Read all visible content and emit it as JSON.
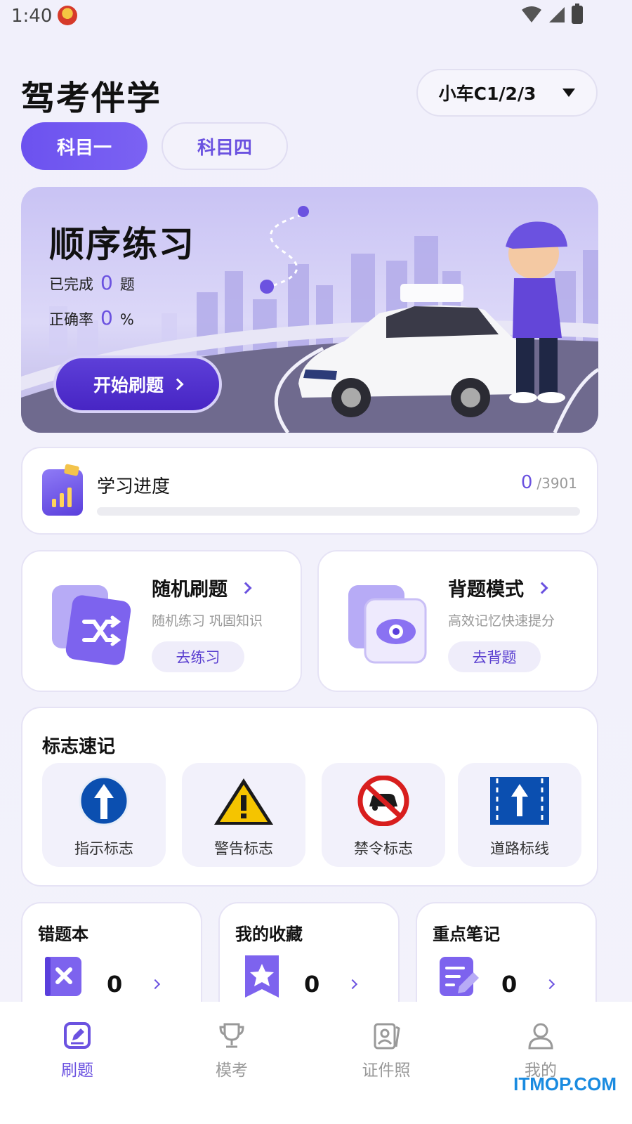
{
  "status_bar": {
    "time": "1:40"
  },
  "header": {
    "title": "驾考伴学",
    "car_type": "小车C1/2/3",
    "tabs": [
      {
        "label": "科目一",
        "active": true
      },
      {
        "label": "科目四",
        "active": false
      }
    ]
  },
  "banner": {
    "title": "顺序练习",
    "done_label": "已完成",
    "done_value": "0",
    "done_unit": "题",
    "rate_label": "正确率",
    "rate_value": "0",
    "rate_unit": "%",
    "button_label": "开始刷题"
  },
  "progress": {
    "label": "学习进度",
    "done": "0",
    "total": "/3901",
    "fraction": 0
  },
  "features": [
    {
      "title": "随机刷题",
      "subtitle": "随机练习 巩固知识",
      "button": "去练习",
      "icon": "shuffle-icon"
    },
    {
      "title": "背题模式",
      "subtitle": "高效记忆快速提分",
      "button": "去背题",
      "icon": "eye-icon"
    }
  ],
  "signs": {
    "title": "标志速记",
    "items": [
      {
        "label": "指示标志",
        "icon": "arrow-up-sign-icon"
      },
      {
        "label": "警告标志",
        "icon": "warning-sign-icon"
      },
      {
        "label": "禁令标志",
        "icon": "no-car-sign-icon"
      },
      {
        "label": "道路标线",
        "icon": "road-marking-icon"
      }
    ]
  },
  "mini_cards": [
    {
      "title": "错题本",
      "count": "0",
      "icon": "wrong-book-icon"
    },
    {
      "title": "我的收藏",
      "count": "0",
      "icon": "favorite-icon"
    },
    {
      "title": "重点笔记",
      "count": "0",
      "icon": "notes-icon"
    }
  ],
  "bottom_nav": [
    {
      "label": "刷题",
      "active": true,
      "icon": "practice-icon"
    },
    {
      "label": "模考",
      "active": false,
      "icon": "trophy-icon"
    },
    {
      "label": "证件照",
      "active": false,
      "icon": "id-photo-icon"
    },
    {
      "label": "我的",
      "active": false,
      "icon": "profile-icon"
    }
  ],
  "watermark": "ITMOP.COM",
  "colors": {
    "accent": "#6b52e0",
    "background": "#f2f1fb",
    "blue_sign": "#0b4fb0",
    "warning": "#f5c400",
    "prohibit": "#d81e1e"
  }
}
